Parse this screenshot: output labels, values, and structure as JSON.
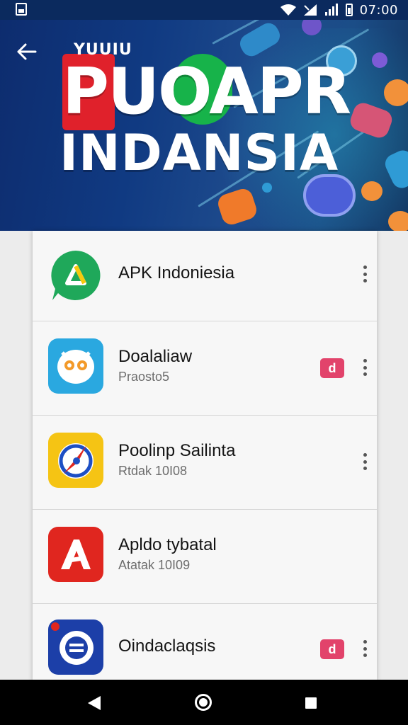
{
  "status_bar": {
    "time": "07:00",
    "icons": [
      "notification-image-icon",
      "wifi-icon",
      "signal-icon",
      "battery-icon"
    ]
  },
  "header": {
    "back_icon": "arrow-left-icon",
    "banner_small_text": "YUUIU",
    "banner_title_line1": "PUOAPR",
    "banner_title_line2": "INDANSIA"
  },
  "apps": [
    {
      "name": "APK Indoniesia",
      "subtitle": "",
      "icon": "green-drive-bubble-icon",
      "badge": "",
      "icon_color": "#1fa85a"
    },
    {
      "name": "Doalaliaw",
      "subtitle": "Praosto5",
      "icon": "owl-face-icon",
      "badge": "d",
      "icon_color": "#2aa8e0"
    },
    {
      "name": "Poolinp Sailinta",
      "subtitle": "Rtdak 10I08",
      "icon": "compass-pin-icon",
      "badge": "",
      "icon_color": "#f5c414"
    },
    {
      "name": "Apldo tybatal",
      "subtitle": "Atatak 10I09",
      "icon": "letter-a-icon",
      "badge": "",
      "icon_color": "#e0261f"
    },
    {
      "name": "Oindaclaqsis",
      "subtitle": "",
      "icon": "ring-e-icon",
      "badge": "d",
      "icon_color": "#1c3fa8"
    }
  ],
  "nav_bar": {
    "back": "nav-back-icon",
    "home": "nav-home-icon",
    "recents": "nav-recents-icon"
  }
}
